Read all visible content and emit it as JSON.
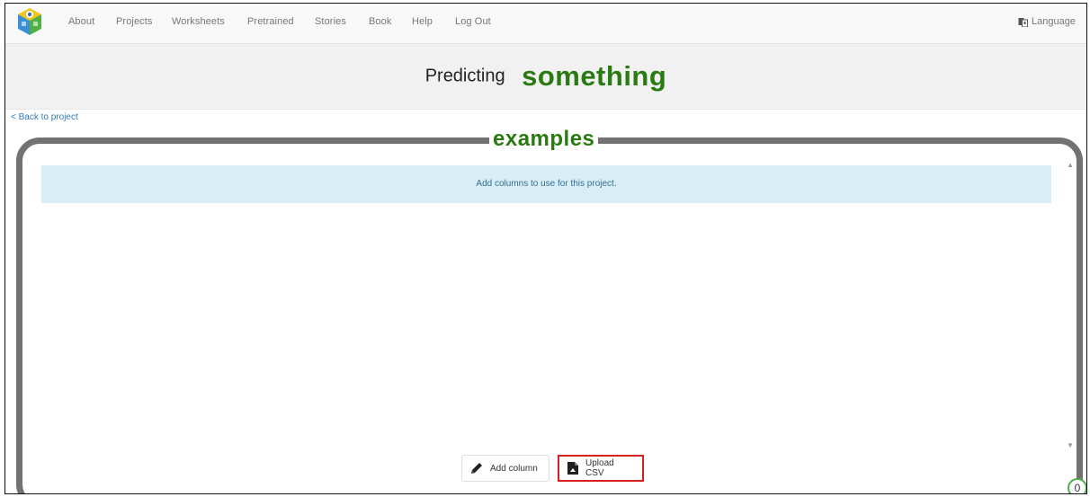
{
  "nav": {
    "items": [
      "About",
      "Projects",
      "Worksheets",
      "Pretrained",
      "Stories",
      "Book",
      "Help",
      "Log Out"
    ],
    "language_label": "Language"
  },
  "header": {
    "predicting_label": "Predicting",
    "project_name": "something"
  },
  "back_link": "< Back to project",
  "examples": {
    "title": "examples",
    "info_message": "Add columns to use for this project.",
    "add_column_label": "Add column",
    "upload_csv_label": "Upload CSV",
    "count": "0"
  },
  "colors": {
    "brand_green": "#2a7a12",
    "info_bg": "#d9edf7",
    "info_text": "#31708f",
    "highlight_red": "#d62020",
    "link_blue": "#337ab7"
  }
}
